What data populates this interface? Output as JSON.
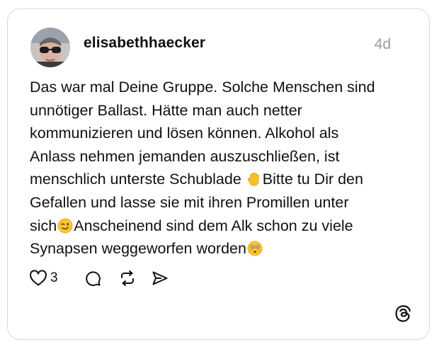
{
  "post": {
    "username": "elisabethhaecker",
    "timestamp": "4d",
    "lines": [
      "Das war mal Deine Gruppe.  Solche Menschen sind",
      "unnötiger Ballast. Hätte man auch netter",
      "kommunizieren und lösen können. Alkohol als",
      "Anlass nehmen jemanden auszuschließen, ist",
      "menschlich unterste Schublade ",
      "Bitte tu Dir den",
      "Gefallen und lasse sie mit ihren Promillen unter",
      "sich",
      "Anscheinend sind dem Alk schon zu viele",
      "Synapsen weggeworfen worden"
    ],
    "emojis": [
      "raised-hand-emoji",
      "winking-face-emoji",
      "flushed-face-emoji"
    ]
  },
  "actions": {
    "like_count": "3",
    "icons": [
      "heart-icon",
      "comment-icon",
      "repost-icon",
      "share-icon"
    ]
  },
  "branding": {
    "logo_icon": "threads-logo-icon"
  },
  "colors": {
    "text": "#101010",
    "muted": "#9a9a9a",
    "border": "#d9d9d9"
  }
}
